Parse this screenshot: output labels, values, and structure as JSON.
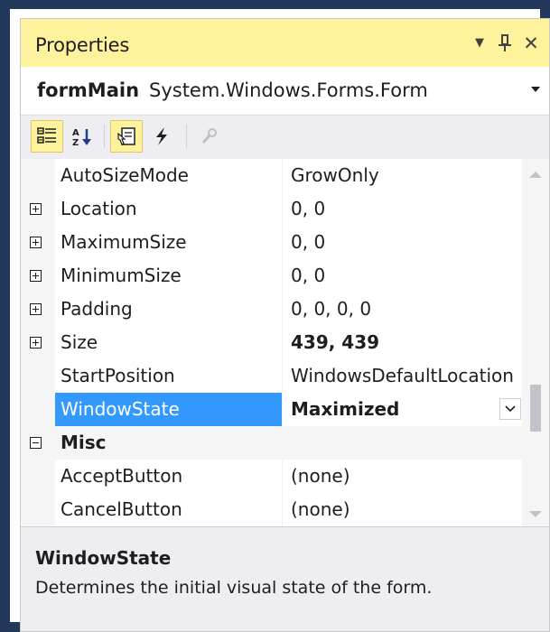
{
  "panel": {
    "title": "Properties",
    "dropdown_glyph": "▼",
    "pin_glyph": "⊥",
    "close_glyph": "✕"
  },
  "object_selector": {
    "name": "formMain",
    "type": "System.Windows.Forms.Form"
  },
  "toolbar": {
    "buttons": [
      {
        "name": "categorized-icon",
        "active": true
      },
      {
        "name": "alphabetical-icon",
        "active": false
      },
      {
        "name": "properties-icon",
        "active": true
      },
      {
        "name": "events-icon",
        "active": false
      },
      {
        "name": "property-pages-icon",
        "active": false,
        "disabled": true
      }
    ]
  },
  "grid": {
    "rows": [
      {
        "name": "AutoSizeMode",
        "value": "GrowOnly",
        "expander": "",
        "bold": false
      },
      {
        "name": "Location",
        "value": "0, 0",
        "expander": "plus",
        "bold": false
      },
      {
        "name": "MaximumSize",
        "value": "0, 0",
        "expander": "plus",
        "bold": false
      },
      {
        "name": "MinimumSize",
        "value": "0, 0",
        "expander": "plus",
        "bold": false
      },
      {
        "name": "Padding",
        "value": "0, 0, 0, 0",
        "expander": "plus",
        "bold": false
      },
      {
        "name": "Size",
        "value": "439, 439",
        "expander": "plus",
        "bold": true
      },
      {
        "name": "StartPosition",
        "value": "WindowsDefaultLocation",
        "expander": "",
        "bold": false
      },
      {
        "name": "WindowState",
        "value": "Maximized",
        "expander": "",
        "bold": true,
        "selected": true
      },
      {
        "name": "Misc",
        "value": "",
        "expander": "minus",
        "category": true
      },
      {
        "name": "AcceptButton",
        "value": "(none)",
        "expander": "",
        "bold": false
      },
      {
        "name": "CancelButton",
        "value": "(none)",
        "expander": "",
        "bold": false
      }
    ]
  },
  "description": {
    "title": "WindowState",
    "text": "Determines the initial visual state of the form."
  },
  "colors": {
    "frame": "#22385b",
    "title_bg": "#fff29d",
    "selection": "#3399ff",
    "toolbar_bg": "#eeeef2"
  }
}
